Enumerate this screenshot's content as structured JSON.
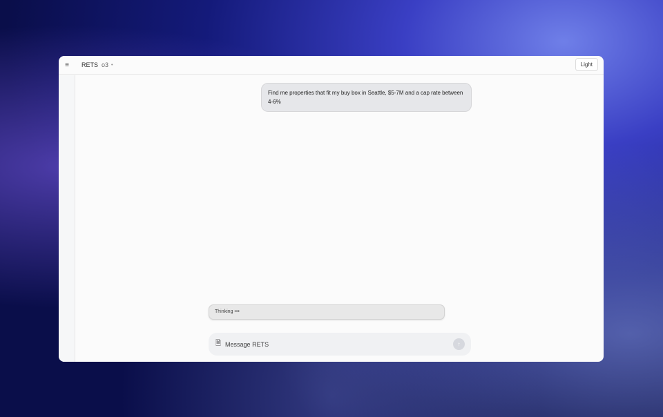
{
  "header": {
    "title": "RETS",
    "model": "o3",
    "theme_button": "Light"
  },
  "chat": {
    "user_message": "Find me properties that fit my buy box in Seattle, $5-7M and a cap rate between 4-6%",
    "status": "Thinking",
    "status_dots": "•••"
  },
  "composer": {
    "placeholder": "Message RETS"
  }
}
